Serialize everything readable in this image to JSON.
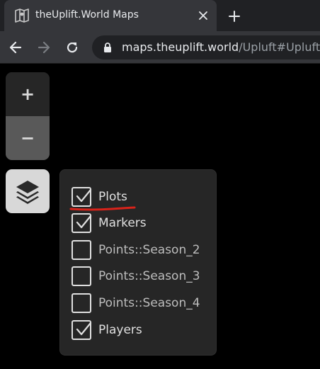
{
  "browser": {
    "tab": {
      "title": "theUplift.World Maps",
      "favicon": "map-icon"
    },
    "url": {
      "host": "maps.theuplift.world",
      "path": "/Upluft#Upluft;f"
    },
    "icons": {
      "back": "back-arrow-icon",
      "forward": "forward-arrow-icon",
      "reload": "reload-icon",
      "lock": "lock-icon",
      "close_tab": "close-icon",
      "new_tab": "plus-icon"
    }
  },
  "map_controls": {
    "zoom_in": "+",
    "zoom_out": "−",
    "layers_icon": "layers-icon"
  },
  "layers": [
    {
      "label": "Plots",
      "checked": true
    },
    {
      "label": "Markers",
      "checked": true
    },
    {
      "label": "Points::Season_2",
      "checked": false
    },
    {
      "label": "Points::Season_3",
      "checked": false
    },
    {
      "label": "Points::Season_4",
      "checked": false
    },
    {
      "label": "Players",
      "checked": true
    }
  ],
  "colors": {
    "chrome_dark": "#202124",
    "chrome_tab": "#35363a",
    "panel": "#262626",
    "annotation_underline": "#d8231a"
  }
}
